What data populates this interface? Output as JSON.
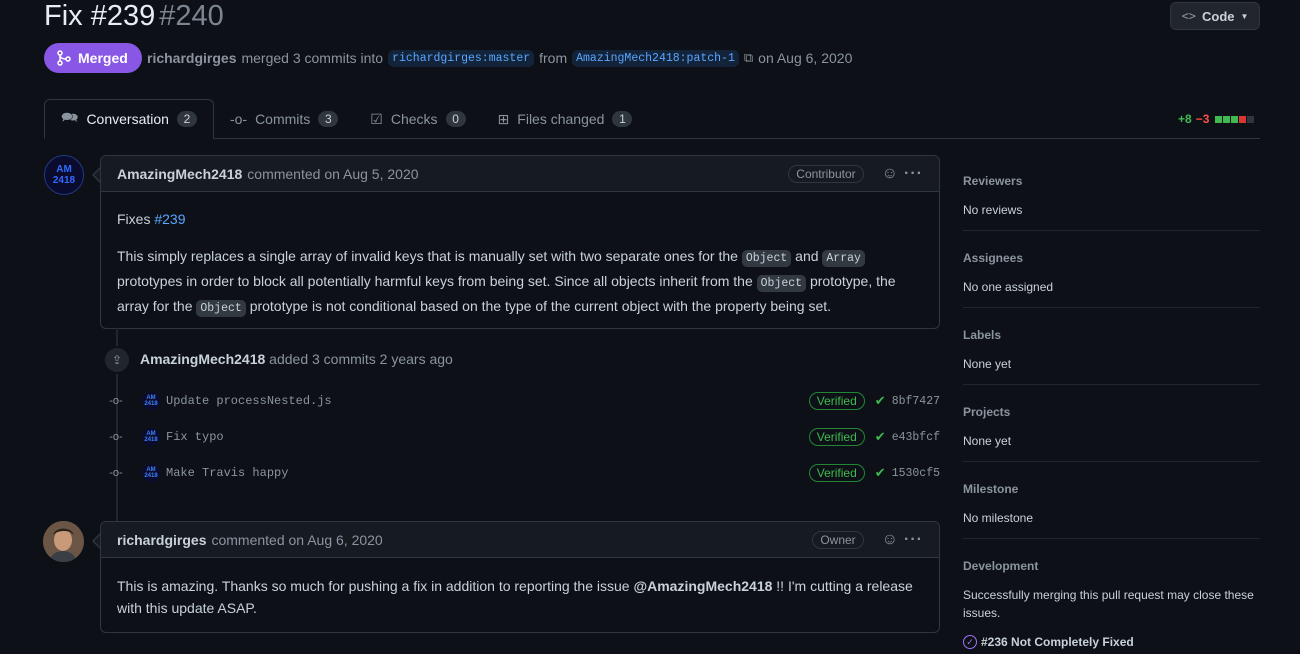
{
  "pr": {
    "title": "Fix #239",
    "number": "#240",
    "state": "Merged",
    "merged_by": "richardgirges",
    "merge_text_a": "merged 3 commits into",
    "base_branch": "richardgirges:master",
    "from_text": "from",
    "head_branch": "AmazingMech2418:patch-1",
    "merge_date": "on Aug 6, 2020"
  },
  "header": {
    "code_label": "Code"
  },
  "tabs": [
    {
      "label": "Conversation",
      "count": "2"
    },
    {
      "label": "Commits",
      "count": "3"
    },
    {
      "label": "Checks",
      "count": "0"
    },
    {
      "label": "Files changed",
      "count": "1"
    }
  ],
  "diffstat": {
    "additions": "+8",
    "deletions": "−3"
  },
  "comment1": {
    "author": "AmazingMech2418",
    "avatar_text": "AM 2418",
    "action": "commented on Aug 5, 2020",
    "role": "Contributor",
    "fixes_prefix": "Fixes",
    "fixes_link": "#239",
    "body_a": "This simply replaces a single array of invalid keys that is manually set with two separate ones for the",
    "code_object": "Object",
    "and": "and",
    "code_array": "Array",
    "body_b": "prototypes in order to block all potentially harmful keys from being set. Since all objects inherit from the",
    "body_c": "prototype, the array for the",
    "body_d": "prototype is not conditional based on the type of the current object with the property being set."
  },
  "timeline": {
    "author": "AmazingMech2418",
    "text": "added 3 commits 2 years ago",
    "commits": [
      {
        "message": "Update processNested.js",
        "status": "Verified",
        "sha": "8bf7427"
      },
      {
        "message": "Fix typo",
        "status": "Verified",
        "sha": "e43bfcf"
      },
      {
        "message": "Make Travis happy",
        "status": "Verified",
        "sha": "1530cf5"
      }
    ]
  },
  "comment2": {
    "author": "richardgirges",
    "action": "commented on Aug 6, 2020",
    "role": "Owner",
    "body_a": "This is amazing. Thanks so much for pushing a fix in addition to reporting the issue",
    "mention": "@AmazingMech2418",
    "body_b": "!! I'm cutting a release with this update ASAP."
  },
  "sidebar": {
    "reviewers": {
      "heading": "Reviewers",
      "value": "No reviews"
    },
    "assignees": {
      "heading": "Assignees",
      "value": "No one assigned"
    },
    "labels": {
      "heading": "Labels",
      "value": "None yet"
    },
    "projects": {
      "heading": "Projects",
      "value": "None yet"
    },
    "milestone": {
      "heading": "Milestone",
      "value": "No milestone"
    },
    "development": {
      "heading": "Development",
      "value": "Successfully merging this pull request may close these issues.",
      "issue": "#236 Not Completely Fixed"
    }
  },
  "colors": {
    "merged": "#8957e5",
    "link": "#58a6ff",
    "verified": "#3fb950",
    "background": "#0d1117"
  }
}
